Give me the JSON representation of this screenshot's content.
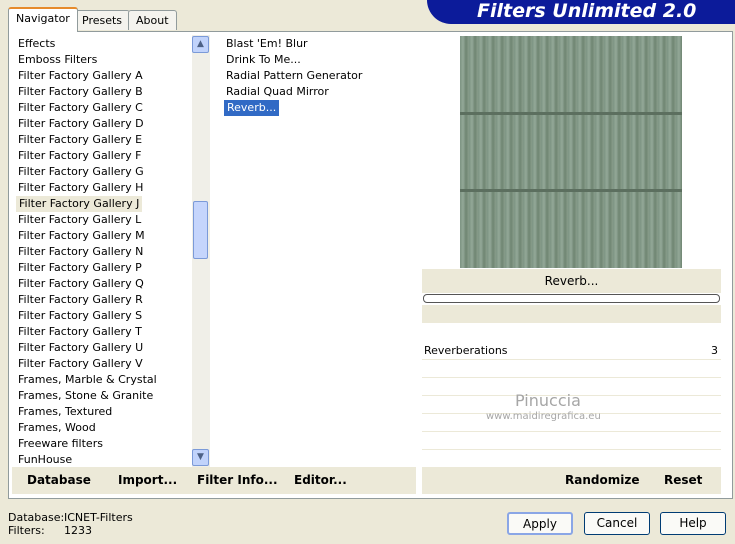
{
  "brand": "Filters Unlimited 2.0",
  "tabs": [
    "Navigator",
    "Presets",
    "About"
  ],
  "categories": [
    "Effects",
    "Emboss Filters",
    "Filter Factory Gallery A",
    "Filter Factory Gallery B",
    "Filter Factory Gallery C",
    "Filter Factory Gallery D",
    "Filter Factory Gallery E",
    "Filter Factory Gallery F",
    "Filter Factory Gallery G",
    "Filter Factory Gallery H",
    "Filter Factory Gallery J",
    "Filter Factory Gallery L",
    "Filter Factory Gallery M",
    "Filter Factory Gallery N",
    "Filter Factory Gallery P",
    "Filter Factory Gallery Q",
    "Filter Factory Gallery R",
    "Filter Factory Gallery S",
    "Filter Factory Gallery T",
    "Filter Factory Gallery U",
    "Filter Factory Gallery V",
    "Frames, Marble & Crystal",
    "Frames, Stone & Granite",
    "Frames, Textured",
    "Frames, Wood",
    "Freeware filters",
    "FunHouse"
  ],
  "filters": [
    "Blast 'Em! Blur",
    "Drink To Me...",
    "Radial Pattern Generator",
    "Radial Quad Mirror",
    "Reverb..."
  ],
  "preview_title": "Reverb...",
  "param": {
    "name": "Reverberations",
    "value": "3"
  },
  "watermark": {
    "name": "Pinuccia",
    "url": "www.maidiregrafica.eu"
  },
  "toolbar": {
    "database": "Database",
    "import": "Import...",
    "filter_info": "Filter Info...",
    "editor": "Editor...",
    "randomize": "Randomize",
    "reset": "Reset"
  },
  "status": {
    "database_label": "Database:",
    "database_value": "ICNET-Filters",
    "filters_label": "Filters:",
    "filters_value": "1233"
  },
  "buttons": {
    "apply": "Apply",
    "cancel": "Cancel",
    "help": "Help"
  }
}
